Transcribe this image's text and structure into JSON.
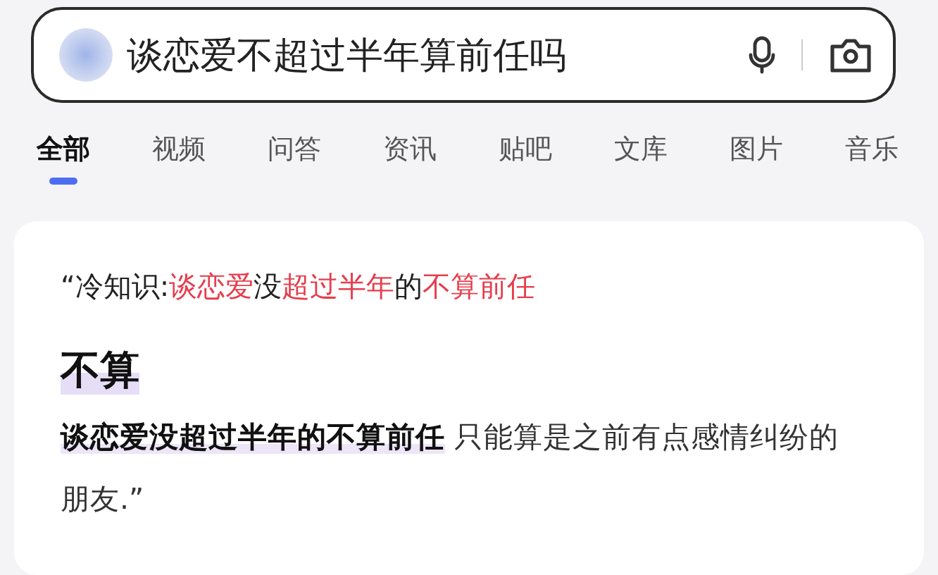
{
  "search": {
    "value": "谈恋爱不超过半年算前任吗"
  },
  "tabs": [
    {
      "label": "全部",
      "selected": true
    },
    {
      "label": "视频",
      "selected": false
    },
    {
      "label": "问答",
      "selected": false
    },
    {
      "label": "资讯",
      "selected": false
    },
    {
      "label": "贴吧",
      "selected": false
    },
    {
      "label": "文库",
      "selected": false
    },
    {
      "label": "图片",
      "selected": false
    },
    {
      "label": "音乐",
      "selected": false
    }
  ],
  "result": {
    "quote_segments": [
      {
        "text": "“冷知识:",
        "highlight": false
      },
      {
        "text": "谈恋爱",
        "highlight": true
      },
      {
        "text": "没",
        "highlight": false
      },
      {
        "text": "超过半年",
        "highlight": true
      },
      {
        "text": "的",
        "highlight": false
      },
      {
        "text": "不算前任",
        "highlight": true
      }
    ],
    "answer": "不算",
    "body": "**谈恋爱没超过半年的不算前任** 只能算是之前有点感情纠纷的朋友.”"
  }
}
